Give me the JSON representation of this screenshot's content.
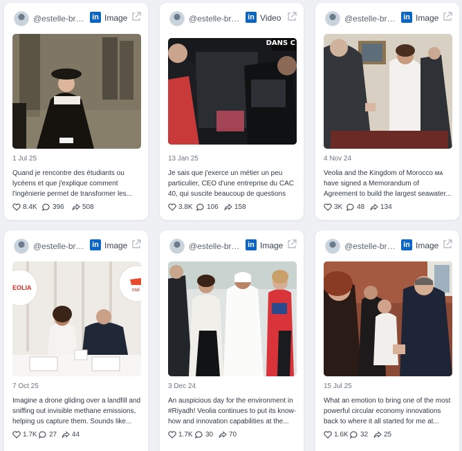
{
  "posts": [
    {
      "handle": "@estelle-brac...",
      "platform": "linkedin",
      "media_type": "Image",
      "date": "1 Jul 25",
      "text": "Quand je rencontre des étudiants ou lycéens et que j'explique comment l'ingénierie permet de transformer les...",
      "likes": "8.4K",
      "comments": "396",
      "shares": "508",
      "image": "woman-uniform-bicorne"
    },
    {
      "handle": "@estelle-brachl...",
      "platform": "linkedin",
      "media_type": "Video",
      "date": "13 Jan 25",
      "text": "Je sais que j'exerce un métier un peu particulier, CEO d'une entreprise du CAC 40, qui suscite beaucoup de questions et...",
      "likes": "3.8K",
      "comments": "106",
      "shares": "158",
      "image": "car-interview",
      "overlay_text": "DANS C"
    },
    {
      "handle": "@estelle-brac...",
      "platform": "linkedin",
      "media_type": "Image",
      "date": "4 Nov 24",
      "text": "Veolia and the Kingdom of Morocco ᴍᴀ have signed a Memorandum of Agreement to build the largest seawater...",
      "likes": "3K",
      "comments": "48",
      "shares": "134",
      "image": "handshake-signing"
    },
    {
      "handle": "@estelle-brac...",
      "platform": "linkedin",
      "media_type": "Image",
      "date": "7 Oct 25",
      "text": "Imagine a drone gliding over a landfill and sniffing out invisible methane emissions, helping us capture them. Sounds like...",
      "likes": "1.7K",
      "comments": "27",
      "shares": "44",
      "image": "signing-table",
      "logo_left": "EOLIA",
      "logo_right": "otal"
    },
    {
      "handle": "@estelle-brac...",
      "platform": "linkedin",
      "media_type": "Image",
      "date": "3 Dec 24",
      "text": "An auspicious day for the environment in #Riyadh! Veolia continues to put its know-how and innovation capabilities at the...",
      "likes": "1.7K",
      "comments": "30",
      "shares": "70",
      "image": "riyadh-group"
    },
    {
      "handle": "@estelle-brac...",
      "platform": "linkedin",
      "media_type": "Image",
      "date": "15 Jul 25",
      "text": "What an emotion to bring one of the most powerful circular economy innovations back to where it all started for me at...",
      "likes": "1.6K",
      "comments": "32",
      "shares": "25",
      "image": "reception-group"
    }
  ],
  "icons": {
    "platform": "linkedin-icon",
    "external": "external-link-icon",
    "likes": "heart-icon",
    "comments": "comment-icon",
    "shares": "share-icon"
  },
  "colors": {
    "linkedin": "#0a66c2",
    "background": "#eef0f4",
    "card": "#ffffff"
  }
}
